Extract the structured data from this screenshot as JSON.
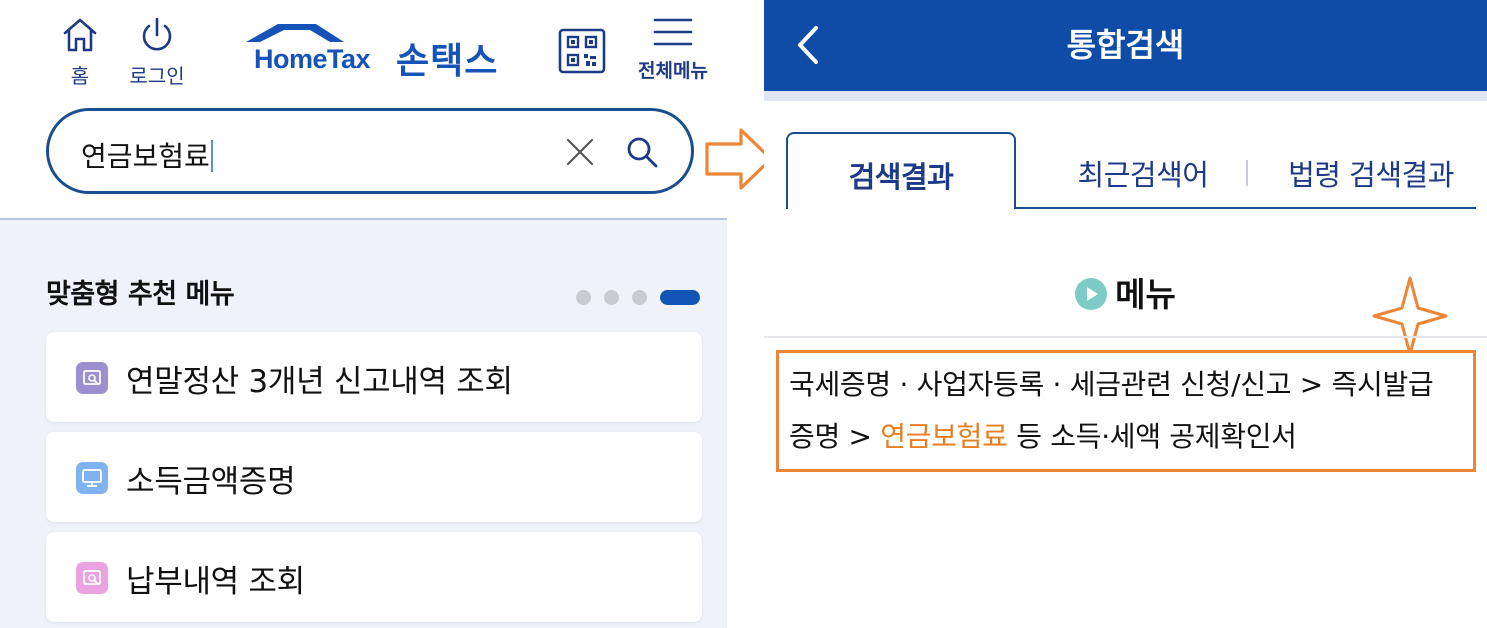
{
  "colors": {
    "brand_blue": "#1553b8",
    "header_blue": "#0f4ca8",
    "navy_text": "#1e3a86",
    "highlight_orange": "#e67e22",
    "annotation_orange": "#ec8535",
    "recommend_bg": "#eff2f9"
  },
  "left": {
    "header": {
      "home": {
        "label": "홈",
        "icon": "home-icon"
      },
      "login": {
        "label": "로그인",
        "icon": "power-icon"
      },
      "logo": {
        "text": "HomeTax",
        "korean": "손택스"
      },
      "qr": {
        "icon": "qr-code-icon"
      },
      "all_menu": {
        "label": "전체메뉴",
        "icon": "hamburger-icon"
      }
    },
    "search": {
      "value": "연금보험료",
      "clear_icon": "close-icon",
      "search_icon": "search-icon"
    },
    "recommend": {
      "title": "맞춤형 추천 메뉴",
      "pagination": {
        "total": 4,
        "active": 4
      },
      "items": [
        {
          "label": "연말정산 3개년 신고내역 조회",
          "icon": "document-search-icon",
          "icon_color": "#9b8fd0"
        },
        {
          "label": "소득금액증명",
          "icon": "monitor-icon",
          "icon_color": "#7fb2ef"
        },
        {
          "label": "납부내역 조회",
          "icon": "document-search-icon",
          "icon_color": "#eaa3e0"
        }
      ]
    }
  },
  "right": {
    "header": {
      "title": "통합검색",
      "back_icon": "chevron-left-icon"
    },
    "tabs": [
      {
        "label": "검색결과",
        "active": true
      },
      {
        "label": "최근검색어",
        "active": false
      },
      {
        "label": "법령 검색결과",
        "active": false
      }
    ],
    "section": {
      "title": "메뉴",
      "icon": "play-circle-icon"
    },
    "result": {
      "prefix": "국세증명 · 사업자등록 · 세금관련 신청/신고 > 즉시발급 증명 > ",
      "highlight": "연금보험료",
      "suffix": " 등 소득·세액 공제확인서"
    }
  }
}
